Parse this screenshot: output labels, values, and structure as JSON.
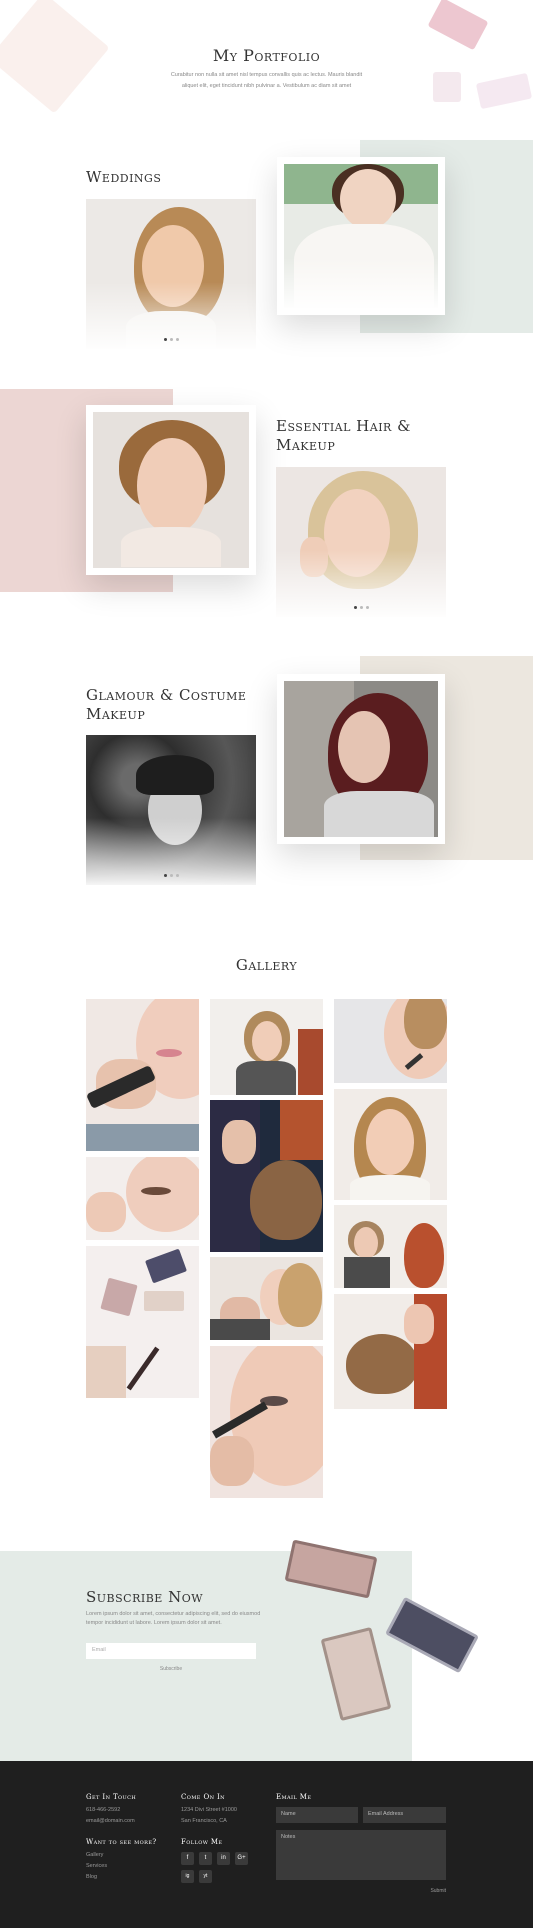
{
  "portfolio": {
    "title": "My Portfolio",
    "subtitle_line1": "Curabitur non nulla sit amet nisl tempus convallis quis ac lectus. Mauris blandit",
    "subtitle_line2": "aliquet elit, eget tincidunt nibh pulvinar a. Vestibulum ac diam sit amet"
  },
  "sections": [
    {
      "title": "Weddings",
      "accent": "#e4ebe7"
    },
    {
      "title_line1": "Essential Hair &",
      "title_line2": "Makeup",
      "accent": "#ecd6d3"
    },
    {
      "title_line1": "Glamour & Costume",
      "title_line2": "Makeup",
      "accent": "#ece7df"
    }
  ],
  "gallery": {
    "title": "Gallery"
  },
  "subscribe": {
    "title": "Subscribe Now",
    "text_line1": "Lorem ipsum dolor sit amet, consectetur adipiscing elit, sed do eiusmod",
    "text_line2": "tempor incididunt ut labore. Lorem ipsum dolor sit amet.",
    "email_placeholder": "Email",
    "button_label": "Subscribe",
    "accent": "#e4ebe7"
  },
  "footer": {
    "get_in_touch": {
      "heading": "Get In Touch",
      "phone": "618-466-2592",
      "email": "email@domain.com"
    },
    "come_on_in": {
      "heading": "Come On In",
      "address1": "1234 Divi Street #1000",
      "address2": "San Francisco, CA"
    },
    "want_more": {
      "heading": "Want to see more?",
      "links": [
        "Gallery",
        "Services",
        "Blog"
      ]
    },
    "follow_me": {
      "heading": "Follow Me",
      "icons": [
        "f",
        "t",
        "in",
        "G+",
        "ig",
        "yt"
      ]
    },
    "email_me": {
      "heading": "Email Me",
      "name_placeholder": "Name",
      "email_placeholder": "Email Address",
      "notes_placeholder": "Notes",
      "submit_label": "Submit"
    },
    "background": "#1f1f1f"
  }
}
